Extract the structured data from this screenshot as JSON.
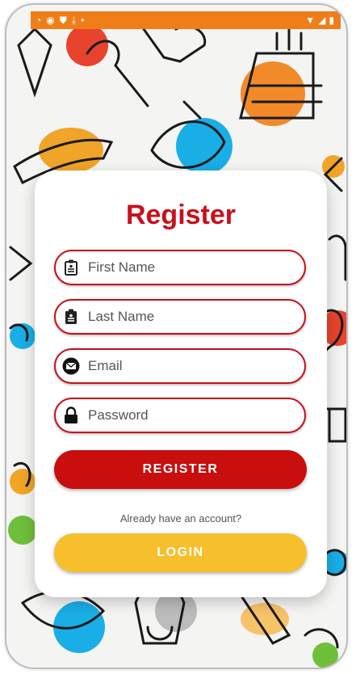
{
  "status_bar": {
    "icons": [
      "notification-icon",
      "vpn-icon",
      "shield-icon",
      "download-icon",
      "dot-icon",
      "wifi-icon",
      "signal-icon",
      "battery-icon"
    ]
  },
  "form": {
    "title": "Register",
    "first_name_placeholder": "First Name",
    "last_name_placeholder": "Last Name",
    "email_placeholder": "Email",
    "password_placeholder": "Password",
    "register_label": "REGISTER",
    "already_text": "Already have an account?",
    "login_label": "LOGIN"
  },
  "colors": {
    "accent_red": "#c8101a",
    "login_yellow": "#f7bf2c",
    "status_orange": "#f07e18"
  }
}
